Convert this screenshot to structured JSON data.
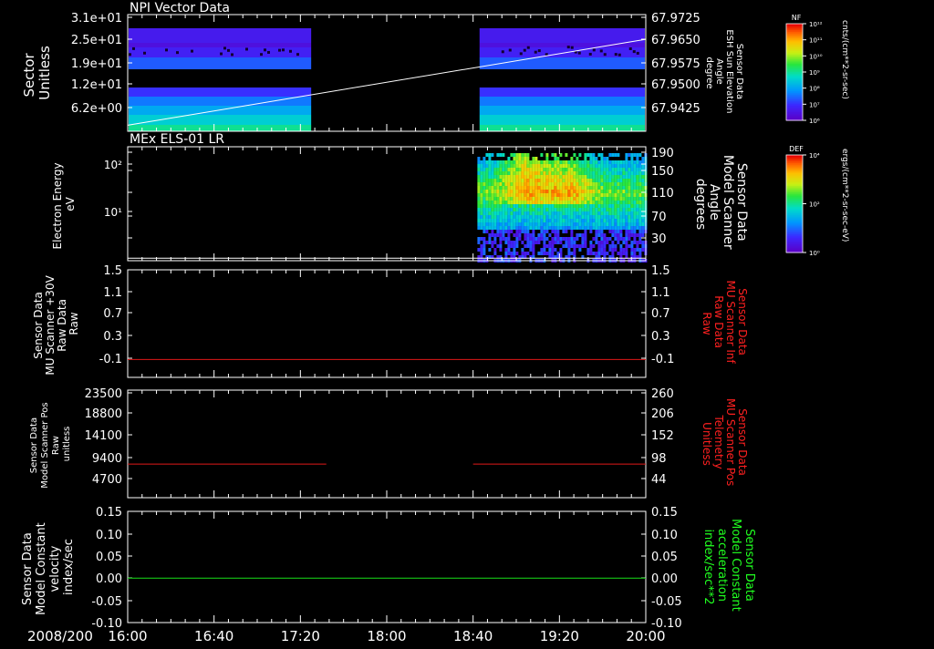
{
  "colors": {
    "background": "#000000",
    "foreground": "#ffffff",
    "red_trace": "#e01818",
    "green_trace": "#18e018",
    "right_label_red": "#ff2020",
    "right_label_green": "#20ff20"
  },
  "footer": {
    "date_label": "2008/200",
    "time_ticks": [
      "16:00",
      "16:40",
      "17:20",
      "18:00",
      "18:40",
      "19:20",
      "20:00"
    ]
  },
  "panels": [
    {
      "id": "npi",
      "title": "NPI Vector Data",
      "left_label": [
        "Sector",
        "Unitless"
      ],
      "right_label": [
        "Sensor Data",
        "ESH Sun Elevation",
        "Angle",
        "degree"
      ],
      "left_ticks": [
        "3.1e+01",
        "2.5e+01",
        "1.9e+01",
        "1.2e+01",
        "6.2e+00"
      ],
      "right_ticks": [
        "67.9725",
        "67.9650",
        "67.9575",
        "67.9500",
        "67.9425"
      ],
      "colorbar": {
        "title": "NF",
        "units": "cnts/(cm**2-sr-sec)",
        "tick_labels": [
          "10¹²",
          "10¹¹",
          "10¹⁰",
          "10⁹",
          "10⁸",
          "10⁷",
          "10⁶"
        ]
      }
    },
    {
      "id": "els",
      "title": "MEx ELS-01 LR",
      "left_label": [
        "Electron Energy",
        "eV"
      ],
      "right_label": [
        "Sensor Data",
        "Model Scanner",
        "Angle",
        "degrees"
      ],
      "left_ticks": [
        "10²",
        "10¹"
      ],
      "right_ticks": [
        "190",
        "150",
        "110",
        "70",
        "30"
      ],
      "colorbar": {
        "title": "DEF",
        "units": "ergs/(cm**2-sr-sec-eV)",
        "tick_labels": [
          "10⁴",
          "10²",
          "10⁰"
        ]
      }
    },
    {
      "id": "mu",
      "left_label": [
        "Sensor Data",
        "MU Scanner +30V",
        "Raw Data",
        "Raw"
      ],
      "right_label": [
        "Sensor Data",
        "MU Scanner Inf",
        "Raw Data",
        "Raw"
      ],
      "left_ticks": [
        "1.5",
        "1.1",
        "0.7",
        "0.3",
        "-0.1"
      ],
      "right_ticks": [
        "1.5",
        "1.1",
        "0.7",
        "0.3",
        "-0.1"
      ]
    },
    {
      "id": "pos",
      "left_label": [
        "Sensor Data",
        "Model Scanner Pos",
        "Raw",
        "unitless"
      ],
      "right_label": [
        "Sensor Data",
        "MU Scanner Pos",
        "Telemetry",
        "Unitless"
      ],
      "left_ticks": [
        "23500",
        "18800",
        "14100",
        "9400",
        "4700"
      ],
      "right_ticks": [
        "260",
        "206",
        "152",
        "98",
        "44"
      ]
    },
    {
      "id": "vel",
      "left_label": [
        "Sensor Data",
        "Model Constant",
        "velocity",
        "index/sec"
      ],
      "right_label": [
        "Sensor Data",
        "Model Constant",
        "acceleration",
        "index/sec**2"
      ],
      "left_ticks": [
        "0.15",
        "0.10",
        "0.05",
        "0.00",
        "-0.05",
        "-0.10"
      ],
      "right_ticks": [
        "0.15",
        "0.10",
        "0.05",
        "0.00",
        "-0.05",
        "-0.10"
      ]
    }
  ],
  "chart_data": [
    {
      "type": "heatmap",
      "title": "NPI Vector Data",
      "xlabel": "",
      "ylabel": "Sector Unitless",
      "x_range": [
        "16:00",
        "20:00"
      ],
      "data_gap": [
        "17:25",
        "18:43"
      ],
      "overlay_line": {
        "name": "ESH Sun Elevation Angle",
        "x": [
          "16:00",
          "20:00"
        ],
        "y": [
          67.9412,
          67.9655
        ],
        "ylim_right": [
          67.9395,
          67.9725
        ]
      }
    },
    {
      "type": "heatmap",
      "title": "MEx ELS-01 LR",
      "ylabel": "Electron Energy eV",
      "yscale": "log",
      "data_start": "18:42",
      "overlay_line": {
        "name": "Model Scanner Angle",
        "x": [
          "16:00",
          "20:00"
        ],
        "y": [
          14,
          14
        ],
        "ylim_right": [
          10,
          190
        ]
      }
    },
    {
      "type": "line",
      "ylim": [
        -0.3,
        1.5
      ],
      "series": [
        {
          "x": [
            "16:00",
            "20:00"
          ],
          "values": [
            0.0,
            0.0
          ]
        }
      ]
    },
    {
      "type": "line",
      "ylim": [
        0,
        23500
      ],
      "segments": [
        {
          "x": [
            "16:00",
            "17:32"
          ],
          "values": [
            7350,
            7350
          ]
        },
        {
          "x": [
            "18:40",
            "20:00"
          ],
          "values": [
            7350,
            7350
          ]
        }
      ]
    },
    {
      "type": "line",
      "ylim": [
        -0.1,
        0.15
      ],
      "series": [
        {
          "x": [
            "16:00",
            "20:00"
          ],
          "values": [
            0.0,
            0.0
          ]
        }
      ]
    }
  ]
}
